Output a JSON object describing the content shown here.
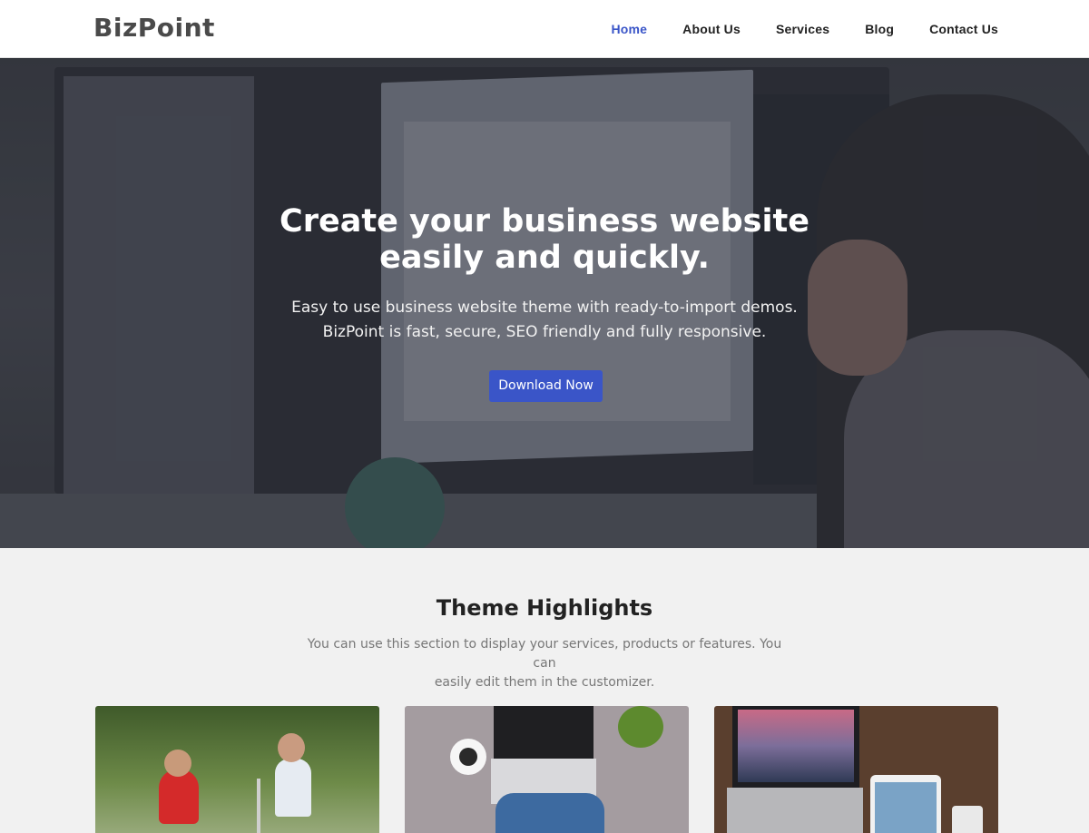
{
  "header": {
    "logo": "BizPoint",
    "nav": [
      {
        "label": "Home",
        "active": true
      },
      {
        "label": "About Us",
        "active": false
      },
      {
        "label": "Services",
        "active": false
      },
      {
        "label": "Blog",
        "active": false
      },
      {
        "label": "Contact Us",
        "active": false
      }
    ]
  },
  "hero": {
    "title_line1": "Create your business website",
    "title_line2": "easily and quickly.",
    "subtitle_line1": "Easy to use business website theme with ready-to-import demos.",
    "subtitle_line2": "BizPoint is fast, secure, SEO friendly and fully responsive.",
    "cta_label": "Download Now"
  },
  "highlights": {
    "title": "Theme Highlights",
    "description_line1": "You can use this section to display your services, products or features. You can",
    "description_line2": "easily edit them in the customizer."
  },
  "colors": {
    "accent": "#3a55c8",
    "nav_text": "#222222",
    "muted_text": "#777777",
    "section_bg": "#f1f1f1"
  }
}
